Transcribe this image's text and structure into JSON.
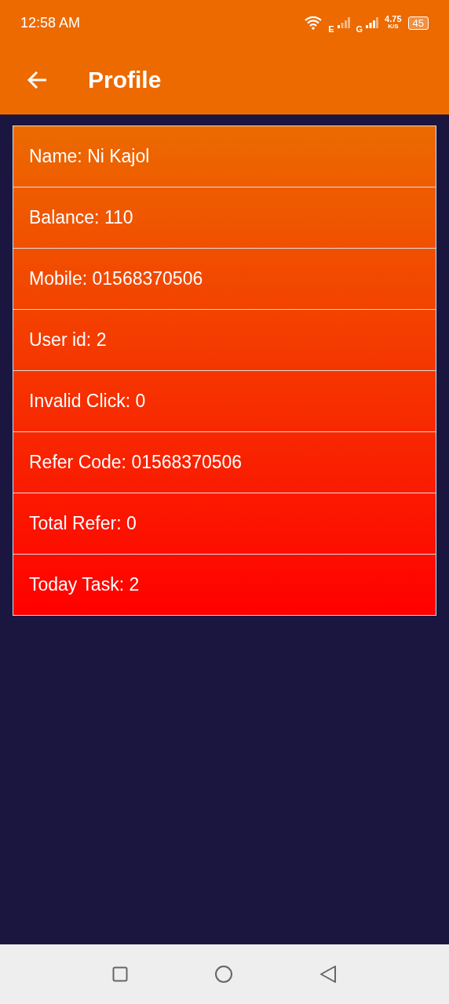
{
  "status_bar": {
    "time": "12:58 AM",
    "network_1": "E",
    "network_2": "G",
    "speed": "4.75",
    "speed_unit": "K/S",
    "battery": "45"
  },
  "app_bar": {
    "title": "Profile"
  },
  "profile": [
    {
      "label": "Name: Ni Kajol"
    },
    {
      "label": "Balance: 110"
    },
    {
      "label": "Mobile: 01568370506"
    },
    {
      "label": "User id: 2"
    },
    {
      "label": "Invalid Click: 0"
    },
    {
      "label": "Refer Code: 01568370506"
    },
    {
      "label": "Total Refer: 0"
    },
    {
      "label": "Today Task: 2"
    }
  ]
}
